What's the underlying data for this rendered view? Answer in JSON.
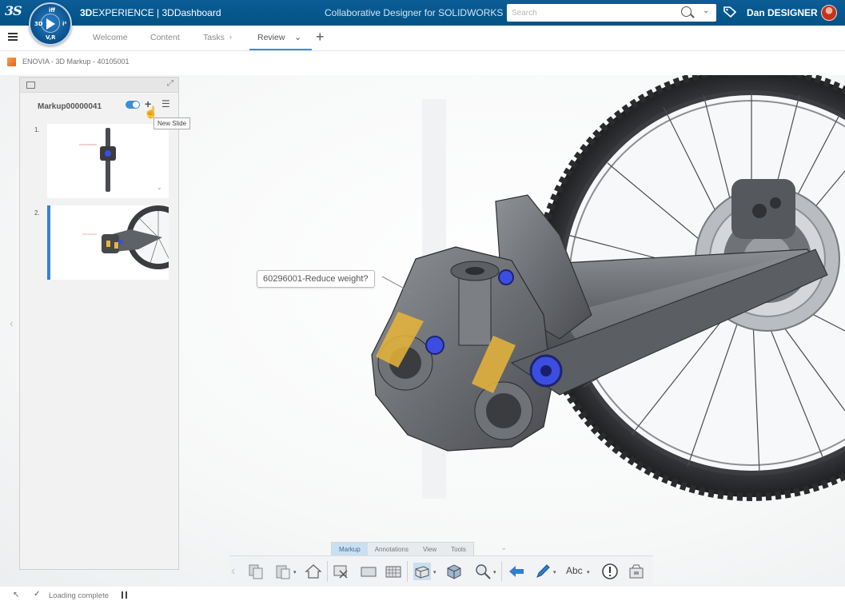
{
  "header": {
    "brand_bold": "3D",
    "brand_rest": "EXPERIENCE | 3DDashboard",
    "app_name": "Collaborative Designer for SOLIDWORKS",
    "user_name": "Dan DESIGNER",
    "compass_version": "V,R"
  },
  "search": {
    "placeholder": "Search"
  },
  "tabs": [
    {
      "label": "Welcome"
    },
    {
      "label": "Content"
    },
    {
      "label": "Tasks"
    },
    {
      "label": "Review"
    }
  ],
  "breadcrumb": "ENOVIA - 3D Markup - 40105001",
  "slide_panel": {
    "markup_name": "Markup00000041",
    "tooltip": "New Slide",
    "slides": [
      {
        "number": "1."
      },
      {
        "number": "2."
      }
    ],
    "selected_slide": 2
  },
  "annotation": "60296001-Reduce weight?",
  "toolbar": {
    "tabs": [
      "Markup",
      "Annotations",
      "View",
      "Tools"
    ],
    "active_tab": "Markup",
    "text_tool_label": "Abc"
  },
  "status": {
    "text": "Loading complete"
  },
  "colors": {
    "topbar": "#005386",
    "accent": "#3a8fd6",
    "highlight": "#e8b53a",
    "bolt_blue": "#3c4ee0",
    "avatar": "#c7321e"
  }
}
